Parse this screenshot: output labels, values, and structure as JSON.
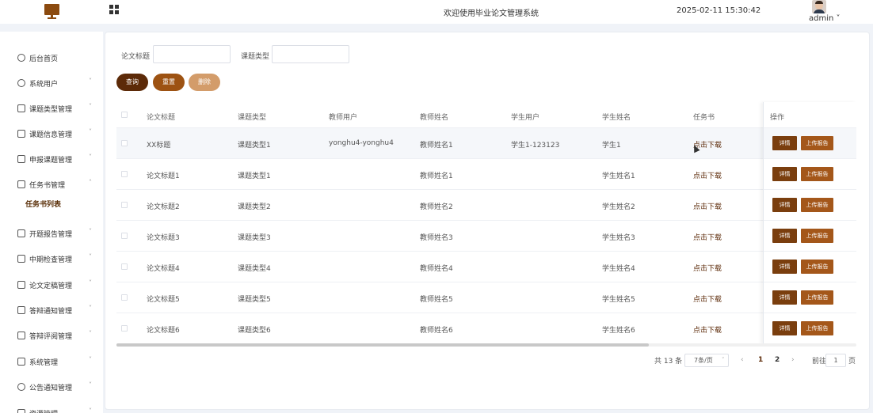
{
  "header": {
    "title": "欢迎使用毕业论文管理系统",
    "datetime": "2025-02-11 15:30:42",
    "user": "admin",
    "user_caret": "˅"
  },
  "sidebar": {
    "items": [
      {
        "label": "后台首页",
        "icon": "clock-icon",
        "chevron": ""
      },
      {
        "label": "系统用户",
        "icon": "user-icon",
        "chevron": "˅"
      },
      {
        "label": "课题类型管理",
        "icon": "list-icon",
        "chevron": "˅"
      },
      {
        "label": "课题信息管理",
        "icon": "list-icon",
        "chevron": "˅"
      },
      {
        "label": "申报课题管理",
        "icon": "list-icon",
        "chevron": "˅"
      },
      {
        "label": "任务书管理",
        "icon": "list-icon",
        "chevron": "˄"
      },
      {
        "label": "开题报告管理",
        "icon": "list-icon",
        "chevron": "˅"
      },
      {
        "label": "中期检查管理",
        "icon": "list-icon",
        "chevron": "˅"
      },
      {
        "label": "论文定稿管理",
        "icon": "list-icon",
        "chevron": "˅"
      },
      {
        "label": "答辩通知管理",
        "icon": "list-icon",
        "chevron": "˅"
      },
      {
        "label": "答辩评阅管理",
        "icon": "list-icon",
        "chevron": "˅"
      },
      {
        "label": "系统管理",
        "icon": "folder-icon",
        "chevron": "˅"
      },
      {
        "label": "公告通知管理",
        "icon": "sun-icon",
        "chevron": "˅"
      },
      {
        "label": "资源管理",
        "icon": "box-icon",
        "chevron": "˅"
      }
    ],
    "active_sub": "任务书列表"
  },
  "search": {
    "title_label": "论文标题",
    "type_label": "课题类型",
    "title_value": "",
    "type_value": ""
  },
  "buttons": {
    "query": "查询",
    "reset": "重置",
    "delete": "删除"
  },
  "table": {
    "headers": [
      "论文标题",
      "课题类型",
      "教师用户",
      "教师姓名",
      "学生用户",
      "学生姓名",
      "任务书",
      "操作"
    ],
    "rows": [
      [
        "XX标题",
        "课题类型1",
        "yonghu4-yonghu4",
        "教师姓名1",
        "学生1-123123",
        "学生1",
        "点击下载"
      ],
      [
        "论文标题1",
        "课题类型1",
        "",
        "教师姓名1",
        "",
        "学生姓名1",
        "点击下载"
      ],
      [
        "论文标题2",
        "课题类型2",
        "",
        "教师姓名2",
        "",
        "学生姓名2",
        "点击下载"
      ],
      [
        "论文标题3",
        "课题类型3",
        "",
        "教师姓名3",
        "",
        "学生姓名3",
        "点击下载"
      ],
      [
        "论文标题4",
        "课题类型4",
        "",
        "教师姓名4",
        "",
        "学生姓名4",
        "点击下载"
      ],
      [
        "论文标题5",
        "课题类型5",
        "",
        "教师姓名5",
        "",
        "学生姓名5",
        "点击下载"
      ],
      [
        "论文标题6",
        "课题类型6",
        "",
        "教师姓名6",
        "",
        "学生姓名6",
        "点击下载"
      ]
    ],
    "detail_label": "详情",
    "upload_label": "上传报告"
  },
  "pagination": {
    "total": "共 13 条",
    "page_size": "7条/页",
    "prev": "‹",
    "next": "›",
    "pages": [
      "1",
      "2"
    ],
    "current": "1",
    "goto_label": "前往",
    "goto_value": "1",
    "page_suffix": "页"
  },
  "colors": {
    "primary": "#5c2a08",
    "accent": "#9d5212",
    "muted": "#d39c6a"
  }
}
